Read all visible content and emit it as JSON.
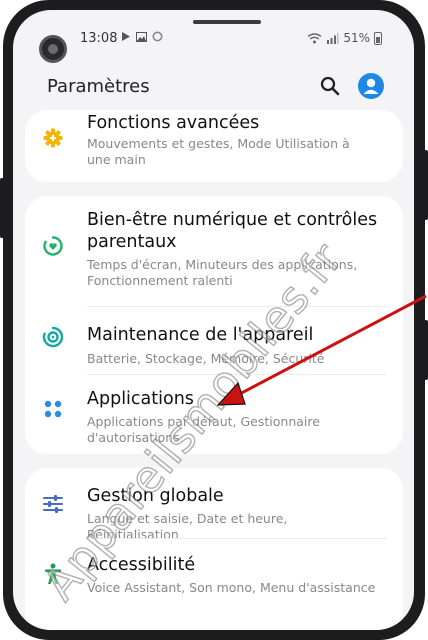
{
  "status_bar": {
    "time": "13:08",
    "battery": "51%"
  },
  "header": {
    "title": "Paramètres"
  },
  "settings": [
    {
      "title": "Fonctions avancées",
      "subtitle": "Mouvements et gestes, Mode Utilisation à une main",
      "icon": "gear-plus-icon",
      "icon_color": "#f6b400"
    },
    {
      "title": "Bien-être numérique et contrôles parentaux",
      "subtitle": "Temps d'écran, Minuteurs des applications, Fonctionnement ralenti",
      "icon": "wellbeing-icon",
      "icon_color": "#20b36b"
    },
    {
      "title": "Maintenance de l'appareil",
      "subtitle": "Batterie, Stockage, Mémoire, Sécurité",
      "icon": "device-care-icon",
      "icon_color": "#12a9a4"
    },
    {
      "title": "Applications",
      "subtitle": "Applications par défaut, Gestionnaire d'autorisations",
      "icon": "apps-grid-icon",
      "icon_color": "#2a8be6"
    },
    {
      "title": "Gestion globale",
      "subtitle": "Langue et saisie, Date et heure, Réinitialisation",
      "icon": "sliders-icon",
      "icon_color": "#4c6bbf"
    },
    {
      "title": "Accessibilité",
      "subtitle": "Voice Assistant, Son mono, Menu d'assistance",
      "icon": "accessibility-icon",
      "icon_color": "#1f9d55"
    }
  ],
  "watermark": {
    "text": "Appareilsmobiles.fr"
  },
  "colors": {
    "accent": "#1e88e5",
    "arrow": "#cc1111"
  }
}
